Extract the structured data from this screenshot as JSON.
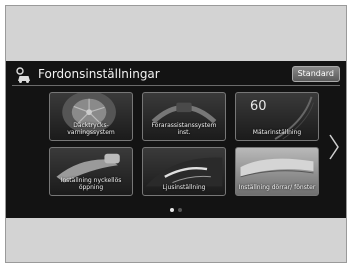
{
  "header": {
    "title": "Fordonsinställningar",
    "standard_button": "Standard"
  },
  "tiles": [
    {
      "label": "Däcktrycks-\nvarningssystem",
      "icon": "tire-icon"
    },
    {
      "label": "Förarassistanssystem inst.",
      "icon": "steering-wheel-icon"
    },
    {
      "label": "Mätarinställning",
      "icon": "gauge-icon",
      "value": "60"
    },
    {
      "label": "Inställning nyckellös öppning",
      "icon": "key-fob-icon"
    },
    {
      "label": "Ljusinställning",
      "icon": "headlight-icon"
    },
    {
      "label": "Inställning dörrar/ fönster",
      "icon": "door-icon"
    }
  ],
  "pagination": {
    "current": 1,
    "total": 2
  },
  "colors": {
    "screen_bg": "#131313",
    "frame_bg": "#d3d3d3"
  }
}
